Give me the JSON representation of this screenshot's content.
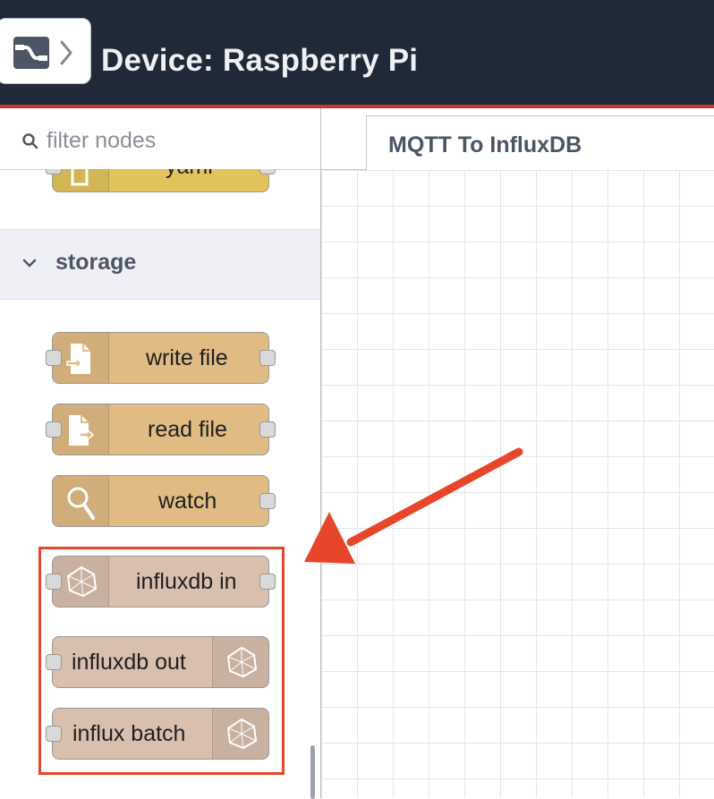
{
  "header": {
    "title": "Device: Raspberry Pi",
    "background": "#1f2937",
    "accent_line": "#c0392b"
  },
  "palette": {
    "filter": {
      "placeholder": "filter nodes",
      "value": ""
    },
    "partial_node": {
      "label": "yaml",
      "color": "#e2c35b"
    },
    "category": {
      "label": "storage",
      "expanded": true
    },
    "nodes": [
      {
        "label": "write file",
        "color": "#e1bb84",
        "icon": "file-write-icon"
      },
      {
        "label": "read file",
        "color": "#e1bb84",
        "icon": "file-read-icon"
      },
      {
        "label": "watch",
        "color": "#e1bb84",
        "icon": "magnifier-icon"
      },
      {
        "label": "influxdb in",
        "color": "#d9bfae",
        "icon": "influxdb-icon"
      },
      {
        "label": "influxdb out",
        "color": "#d9bfae",
        "icon": "influxdb-icon"
      },
      {
        "label": "influx batch",
        "color": "#d9bfae",
        "icon": "influxdb-icon"
      }
    ],
    "highlight_color": "#e8462a"
  },
  "workspace": {
    "tabs": [
      {
        "label": "MQTT To InfluxDB",
        "active": true
      }
    ]
  }
}
